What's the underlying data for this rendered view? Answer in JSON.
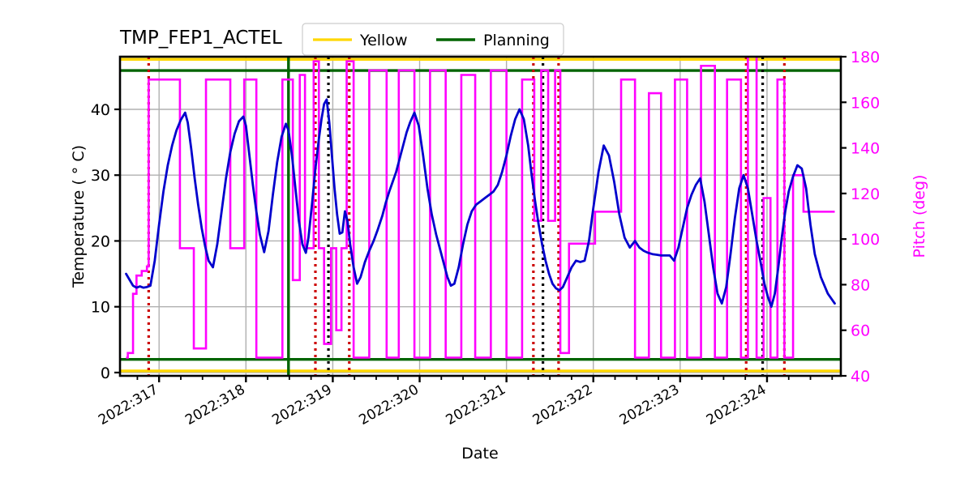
{
  "chart_data": {
    "type": "line",
    "title": "TMP_FEP1_ACTEL",
    "xlabel": "Date",
    "ylabel": "Temperature ( ° C)",
    "ylabel_right": "Pitch (deg)",
    "grid": true,
    "legend_position": "upper center",
    "xlim": [
      316.55,
      324.85
    ],
    "ylim": [
      -0.5,
      48.0
    ],
    "ylim_right": [
      40,
      180
    ],
    "xticks": [
      "2022:317",
      "2022:318",
      "2022:319",
      "2022:320",
      "2022:321",
      "2022:322",
      "2022:323",
      "2022:324"
    ],
    "xtick_values": [
      317,
      318,
      319,
      320,
      321,
      322,
      323,
      324
    ],
    "yticks": [
      0,
      10,
      20,
      30,
      40
    ],
    "yticks_right": [
      40,
      60,
      80,
      100,
      120,
      140,
      160,
      180
    ],
    "legend": [
      {
        "name": "Yellow",
        "color": "#ffd700"
      },
      {
        "name": "Planning",
        "color": "#006400"
      }
    ],
    "colors": {
      "temperature": "#0000cd",
      "pitch": "#ff00ff",
      "yellow_limit": "#ffd700",
      "planning_limit": "#006400",
      "red_marker": "#cc0000",
      "black_marker": "#000000",
      "grid": "#b0b0b0",
      "axes": "#000000"
    },
    "yellow_limits": [
      47.6,
      0.25
    ],
    "planning_limits": [
      45.9,
      2.0
    ],
    "planning_event_x": [
      318.49
    ],
    "red_event_x": [
      316.88,
      318.8,
      319.19,
      321.31,
      321.6,
      323.76,
      324.2
    ],
    "black_event_x": [
      318.95,
      321.42,
      323.95
    ],
    "series": [
      {
        "name": "Temperature",
        "axis": "left",
        "color": "#0000cd",
        "x": [
          316.62,
          316.66,
          316.7,
          316.74,
          316.78,
          316.82,
          316.86,
          316.9,
          316.95,
          317.0,
          317.05,
          317.1,
          317.15,
          317.2,
          317.25,
          317.3,
          317.33,
          317.37,
          317.41,
          317.45,
          317.49,
          317.53,
          317.57,
          317.62,
          317.67,
          317.72,
          317.77,
          317.82,
          317.87,
          317.92,
          317.97,
          318.0,
          318.04,
          318.08,
          318.12,
          318.16,
          318.21,
          318.26,
          318.31,
          318.36,
          318.41,
          318.46,
          318.49,
          318.53,
          318.57,
          318.61,
          318.65,
          318.69,
          318.72,
          318.76,
          318.8,
          318.84,
          318.87,
          318.9,
          318.93,
          318.96,
          318.99,
          319.02,
          319.05,
          319.08,
          319.11,
          319.14,
          319.17,
          319.2,
          319.24,
          319.28,
          319.32,
          319.37,
          319.42,
          319.47,
          319.52,
          319.57,
          319.61,
          319.65,
          319.69,
          319.73,
          319.77,
          319.81,
          319.85,
          319.89,
          319.94,
          319.99,
          320.04,
          320.09,
          320.14,
          320.19,
          320.24,
          320.28,
          320.32,
          320.36,
          320.4,
          320.45,
          320.5,
          320.55,
          320.6,
          320.65,
          320.7,
          320.75,
          320.8,
          320.85,
          320.9,
          320.95,
          321.0,
          321.05,
          321.1,
          321.15,
          321.2,
          321.25,
          321.29,
          321.33,
          321.37,
          321.41,
          321.45,
          321.49,
          321.53,
          321.57,
          321.61,
          321.65,
          321.7,
          321.75,
          321.8,
          321.85,
          321.9,
          321.95,
          322.0,
          322.06,
          322.12,
          322.18,
          322.24,
          322.3,
          322.36,
          322.42,
          322.48,
          322.53,
          322.58,
          322.63,
          322.68,
          322.73,
          322.78,
          322.83,
          322.88,
          322.93,
          322.98,
          323.03,
          323.08,
          323.13,
          323.18,
          323.23,
          323.28,
          323.33,
          323.38,
          323.43,
          323.48,
          323.53,
          323.58,
          323.63,
          323.68,
          323.73,
          323.78,
          323.83,
          323.88,
          323.93,
          323.97,
          324.01,
          324.05,
          324.09,
          324.13,
          324.17,
          324.21,
          324.25,
          324.3,
          324.35,
          324.4,
          324.45,
          324.5,
          324.55,
          324.62,
          324.7,
          324.78
        ],
        "y": [
          15.0,
          14.1,
          13.2,
          12.9,
          13.1,
          12.9,
          13.0,
          13.2,
          17.0,
          22.5,
          27.5,
          31.5,
          34.5,
          36.8,
          38.4,
          39.5,
          38.0,
          34.0,
          29.5,
          25.5,
          22.0,
          19.2,
          17.0,
          16.0,
          19.5,
          24.5,
          29.5,
          33.5,
          36.3,
          38.2,
          38.9,
          37.5,
          33.0,
          28.5,
          24.5,
          21.0,
          18.3,
          21.5,
          27.0,
          32.0,
          35.8,
          37.8,
          36.8,
          33.0,
          28.0,
          23.0,
          19.5,
          18.2,
          20.5,
          25.5,
          31.0,
          35.5,
          38.5,
          40.8,
          41.5,
          38.0,
          33.0,
          28.0,
          24.0,
          21.1,
          21.3,
          24.5,
          23.0,
          19.5,
          16.0,
          13.5,
          14.5,
          16.8,
          18.5,
          20.0,
          21.8,
          23.8,
          25.8,
          27.5,
          29.0,
          30.5,
          32.5,
          34.5,
          36.5,
          38.0,
          39.5,
          37.5,
          33.0,
          28.0,
          24.0,
          21.0,
          18.5,
          16.5,
          14.5,
          13.2,
          13.5,
          16.0,
          19.5,
          22.5,
          24.5,
          25.5,
          26.0,
          26.5,
          27.0,
          27.5,
          28.5,
          30.5,
          33.0,
          36.0,
          38.5,
          40.0,
          38.5,
          34.5,
          30.0,
          26.0,
          22.5,
          19.5,
          17.0,
          15.0,
          13.5,
          12.8,
          12.5,
          13.0,
          14.5,
          16.0,
          17.0,
          16.8,
          17.0,
          20.0,
          25.0,
          30.5,
          34.5,
          33.0,
          29.0,
          24.0,
          20.5,
          19.0,
          20.0,
          19.0,
          18.5,
          18.2,
          18.0,
          17.9,
          17.8,
          17.8,
          17.8,
          17.0,
          19.0,
          22.0,
          25.0,
          27.0,
          28.5,
          29.5,
          26.0,
          21.0,
          16.0,
          12.0,
          10.5,
          13.0,
          18.0,
          23.5,
          28.0,
          30.0,
          28.0,
          24.0,
          20.0,
          16.5,
          13.5,
          11.5,
          10.0,
          12.0,
          16.0,
          20.5,
          24.5,
          27.5,
          29.8,
          31.5,
          31.0,
          28.0,
          22.5,
          18.0,
          14.5,
          12.0,
          10.5,
          13.0,
          16.5,
          19.0,
          20.0,
          19.0,
          17.5,
          16.5,
          15.8,
          15.5,
          15.5
        ]
      },
      {
        "name": "Pitch",
        "axis": "right",
        "color": "#ff00ff",
        "step": true,
        "x": [
          316.62,
          316.64,
          316.7,
          316.74,
          316.8,
          316.86,
          316.88,
          317.22,
          317.24,
          317.38,
          317.4,
          317.52,
          317.54,
          317.8,
          317.82,
          317.96,
          317.98,
          318.1,
          318.12,
          318.4,
          318.42,
          318.52,
          318.54,
          318.6,
          318.62,
          318.66,
          318.68,
          318.76,
          318.78,
          318.82,
          318.84,
          318.88,
          318.9,
          318.96,
          318.98,
          319.02,
          319.04,
          319.08,
          319.1,
          319.14,
          319.16,
          319.22,
          319.24,
          319.4,
          319.42,
          319.6,
          319.62,
          319.74,
          319.76,
          319.92,
          319.94,
          320.1,
          320.12,
          320.28,
          320.3,
          320.46,
          320.48,
          320.62,
          320.64,
          320.8,
          320.82,
          320.98,
          321.0,
          321.16,
          321.18,
          321.3,
          321.32,
          321.38,
          321.4,
          321.46,
          321.48,
          321.54,
          321.56,
          321.6,
          321.62,
          321.7,
          321.72,
          322.0,
          322.02,
          322.3,
          322.32,
          322.46,
          322.48,
          322.62,
          322.64,
          322.76,
          322.78,
          322.92,
          322.94,
          323.06,
          323.08,
          323.22,
          323.24,
          323.38,
          323.4,
          323.52,
          323.54,
          323.68,
          323.7,
          323.76,
          323.78,
          323.86,
          323.88,
          323.94,
          323.96,
          324.02,
          324.04,
          324.1,
          324.12,
          324.18,
          324.2,
          324.28,
          324.3,
          324.4,
          324.42,
          324.78
        ],
        "y": [
          48,
          50,
          76,
          84,
          86,
          88,
          170,
          170,
          96,
          96,
          52,
          52,
          170,
          170,
          96,
          96,
          170,
          170,
          48,
          48,
          170,
          170,
          82,
          82,
          172,
          172,
          96,
          96,
          178,
          178,
          96,
          96,
          54,
          54,
          96,
          96,
          60,
          60,
          96,
          96,
          178,
          178,
          48,
          48,
          174,
          174,
          48,
          48,
          174,
          174,
          48,
          48,
          174,
          174,
          48,
          48,
          172,
          172,
          48,
          48,
          174,
          174,
          48,
          48,
          170,
          170,
          108,
          108,
          174,
          174,
          108,
          108,
          174,
          174,
          50,
          50,
          98,
          98,
          112,
          112,
          170,
          170,
          48,
          48,
          164,
          164,
          48,
          48,
          170,
          170,
          48,
          48,
          176,
          176,
          48,
          48,
          170,
          170,
          48,
          48,
          182,
          182,
          48,
          48,
          118,
          118,
          48,
          48,
          170,
          170,
          48,
          48,
          128,
          128,
          112,
          112
        ]
      }
    ]
  }
}
